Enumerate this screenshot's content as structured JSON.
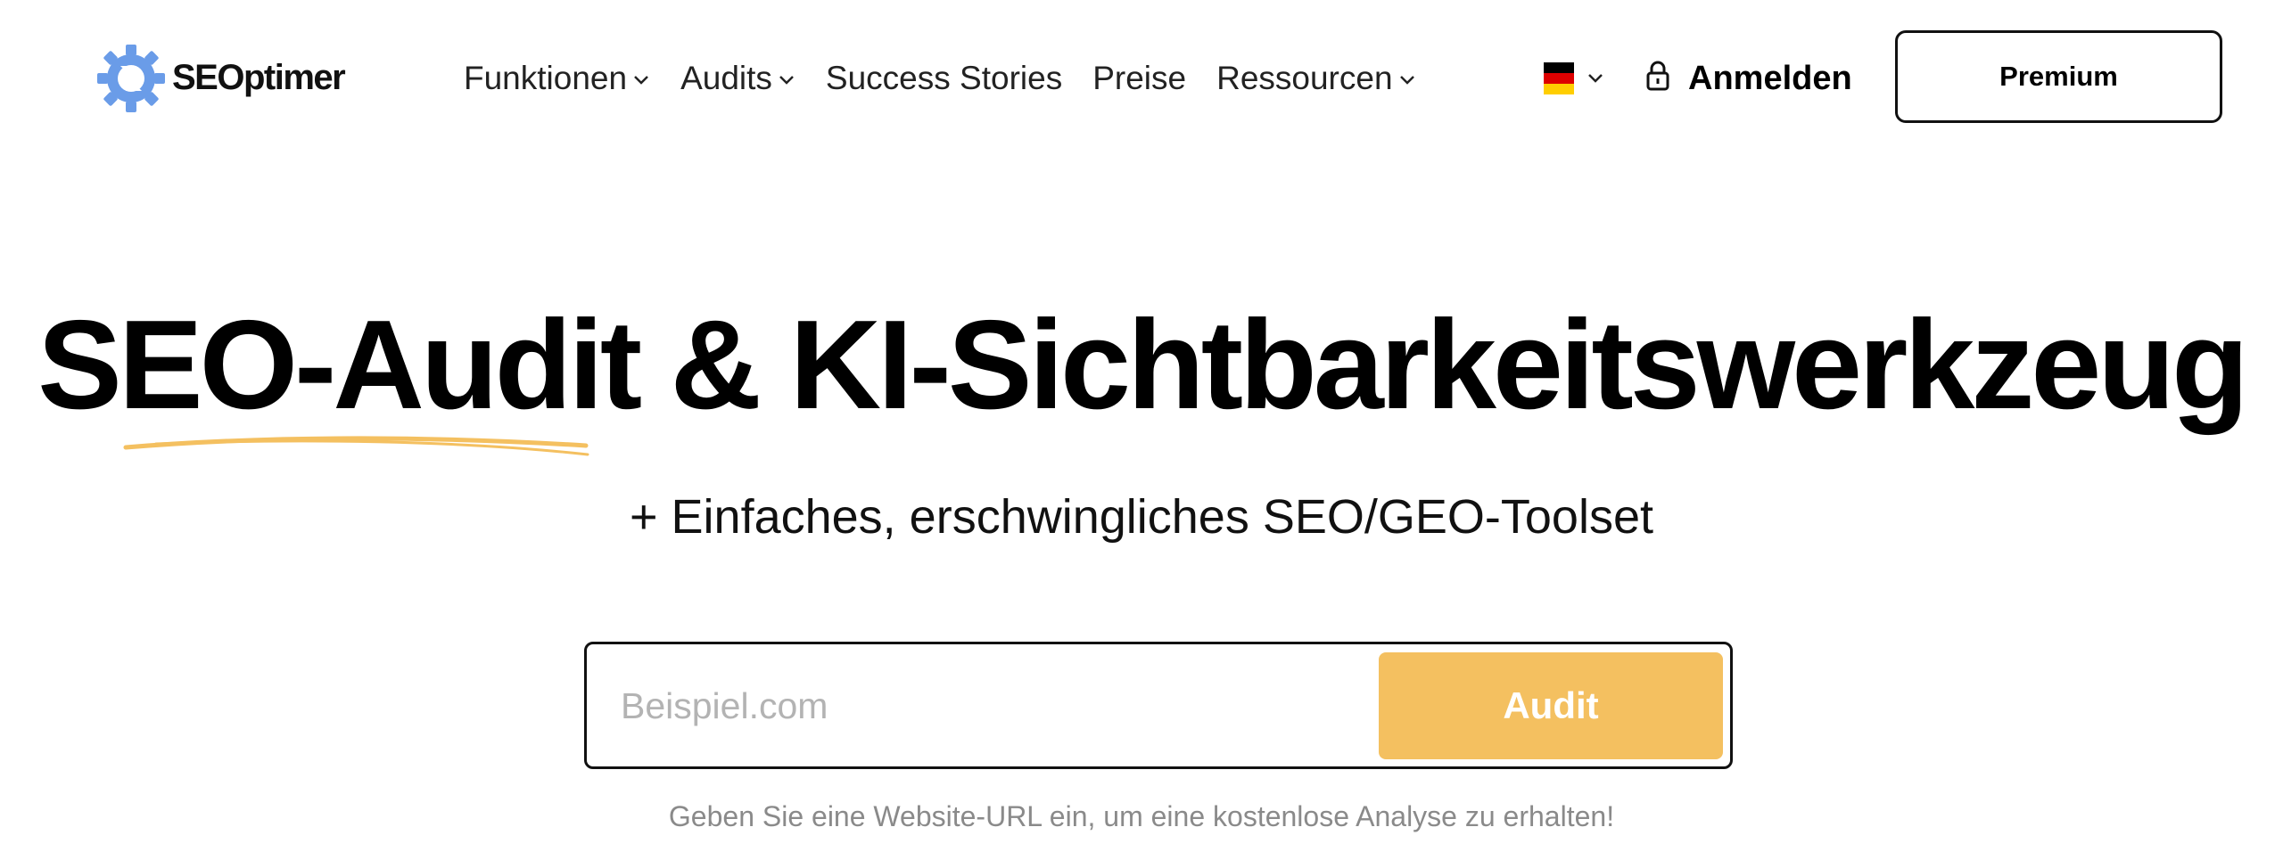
{
  "brand": {
    "name": "SEOptimer",
    "logo_color": "#6a9ce8"
  },
  "nav": {
    "items": [
      {
        "label": "Funktionen",
        "has_dropdown": true
      },
      {
        "label": "Audits",
        "has_dropdown": true
      },
      {
        "label": "Success Stories",
        "has_dropdown": false
      },
      {
        "label": "Preise",
        "has_dropdown": false
      },
      {
        "label": "Ressourcen",
        "has_dropdown": true
      }
    ],
    "language": {
      "icon": "german-flag-icon",
      "colors": [
        "#000000",
        "#dd0000",
        "#ffce00"
      ]
    },
    "login_label": "Anmelden",
    "premium_label": "Premium"
  },
  "hero": {
    "title": "SEO-Audit & KI-Sichtbarkeitswerkzeug",
    "subtitle": "+ Einfaches, erschwingliches SEO/GEO-Toolset",
    "accent_color": "#f4c060"
  },
  "search": {
    "placeholder": "Beispiel.com",
    "value": "",
    "button_label": "Audit",
    "helper": "Geben Sie eine Website-URL ein, um eine kostenlose Analyse zu erhalten!"
  }
}
